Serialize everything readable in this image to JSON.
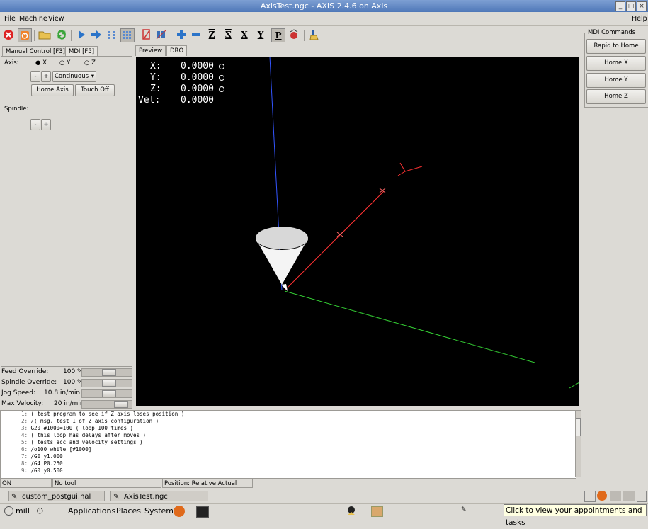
{
  "window": {
    "title": "AxisTest.ngc - AXIS 2.4.6 on Axis"
  },
  "menubar": {
    "file": "File",
    "machine": "Machine",
    "view": "View",
    "help": "Help"
  },
  "toolbar": {
    "icons": [
      "estop-icon",
      "machine-power-icon",
      "open-file-icon",
      "reload-icon",
      "run-icon",
      "step-icon",
      "pause-icon",
      "stop-icon",
      "block-delete-icon",
      "optional-stop-icon",
      "zoom-in-icon",
      "zoom-out-icon",
      "view-z-icon",
      "view-z2-icon",
      "view-x-icon",
      "view-y-icon",
      "view-p-icon",
      "rotate-view-icon",
      "clear-plot-icon"
    ],
    "view_labels": {
      "z": "Z",
      "z2": "Z",
      "x": "X",
      "y": "Y",
      "p": "P"
    }
  },
  "left_tabs": {
    "manual": "Manual Control [F3]",
    "mdi": "MDI [F5]"
  },
  "manual": {
    "axis_label": "Axis:",
    "axis_options": [
      "X",
      "Y",
      "Z"
    ],
    "selected_axis": "X",
    "jog_minus": "-",
    "jog_plus": "+",
    "jog_mode": "Continuous",
    "home_axis": "Home Axis",
    "touch_off": "Touch Off",
    "spindle_label": "Spindle:",
    "spindle_minus": "-",
    "spindle_plus": "+"
  },
  "overrides": [
    {
      "label": "Feed Override:",
      "value": "100 %",
      "level": 0.55
    },
    {
      "label": "Spindle Override:",
      "value": "100 %",
      "level": 0.55
    },
    {
      "label": "Jog Speed:",
      "value": "10.8 in/min",
      "level": 0.55
    },
    {
      "label": "Max Velocity:",
      "value": "20 in/min",
      "level": 0.9
    }
  ],
  "view_tabs": {
    "preview": "Preview",
    "dro": "DRO"
  },
  "dro": {
    "x_label": "X:",
    "x_value": "0.0000",
    "y_label": "Y:",
    "y_value": "0.0000",
    "z_label": "Z:",
    "z_value": "0.0000",
    "vel_label": "Vel:",
    "vel_value": "0.0000"
  },
  "mdi_commands": {
    "title": "MDI Commands",
    "buttons": [
      "Rapid to Home",
      "Home X",
      "Home Y",
      "Home Z"
    ]
  },
  "gcode": [
    {
      "n": "1:",
      "text": "( test program to see if Z axis loses position )"
    },
    {
      "n": "2:",
      "text": "/( msg, test 1 of Z axis configuration )"
    },
    {
      "n": "3:",
      "text": "G20 #1000=100 ( loop 100 times )"
    },
    {
      "n": "4:",
      "text": "( this loop has delays after moves )"
    },
    {
      "n": "5:",
      "text": "( tests acc and velocity settings )"
    },
    {
      "n": "6:",
      "text": "/o100 while [#1000]"
    },
    {
      "n": "7:",
      "text": "/G0 y1.000"
    },
    {
      "n": "8:",
      "text": "/G4 P0.250"
    },
    {
      "n": "9:",
      "text": "/G0 y0.500"
    }
  ],
  "statusbar": {
    "state": "ON",
    "tool": "No tool",
    "position": "Position: Relative Actual"
  },
  "taskbar": {
    "task1": "custom_postgui.hal (~...",
    "task2": "AxisTest.ngc"
  },
  "panel": {
    "user": "mill",
    "applications": "Applications",
    "places": "Places",
    "system": "System",
    "tooltip": "Click to view your appointments and tasks"
  },
  "colors": {
    "titlebar": "#5a82c0",
    "background": "#dcdad5",
    "preview_bg": "#000000",
    "z_axis": "#3355ff",
    "x_axis": "#33cc33",
    "toolpath": "#ff3333"
  }
}
